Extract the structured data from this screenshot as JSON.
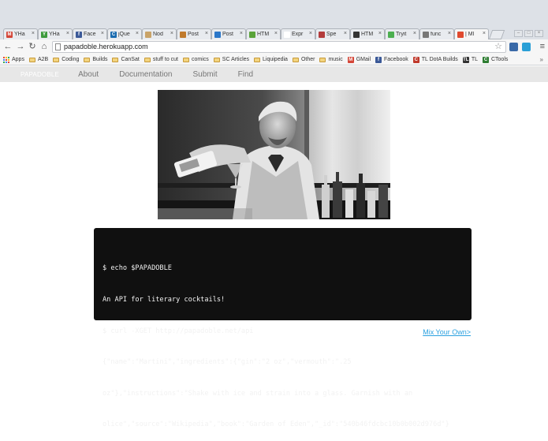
{
  "browser": {
    "tabs": [
      {
        "label": "YHa",
        "fav": "M",
        "color": "#d44638"
      },
      {
        "label": "YHa",
        "fav": "Y",
        "color": "#3d9a3d"
      },
      {
        "label": "Face",
        "fav": "f",
        "color": "#3b5998"
      },
      {
        "label": "jQue",
        "fav": "C",
        "color": "#1a6bb0"
      },
      {
        "label": "Nod",
        "fav": "",
        "color": "#c9a368"
      },
      {
        "label": "Post",
        "fav": "",
        "color": "#c07a2c"
      },
      {
        "label": "Post",
        "fav": "",
        "color": "#2b77c9"
      },
      {
        "label": "HTM",
        "fav": "",
        "color": "#5aa33a"
      },
      {
        "label": "Expr",
        "fav": "",
        "color": "#ffffff"
      },
      {
        "label": "Spe",
        "fav": "",
        "color": "#b33c3c"
      },
      {
        "label": "HTM",
        "fav": "",
        "color": "#333333"
      },
      {
        "label": "Tryit",
        "fav": "",
        "color": "#4caf50"
      },
      {
        "label": "func",
        "fav": "",
        "color": "#777777"
      },
      {
        "label": "| MI",
        "fav": "",
        "color": "#e04a2f"
      }
    ],
    "active_tab": 13,
    "url": "papadoble.herokuapp.com",
    "bookmarks": [
      {
        "label": "Apps",
        "type": "apps"
      },
      {
        "label": "A2B",
        "type": "folder"
      },
      {
        "label": "Coding",
        "type": "folder"
      },
      {
        "label": "Builds",
        "type": "folder"
      },
      {
        "label": "CanSat",
        "type": "folder"
      },
      {
        "label": "stuff to cut",
        "type": "folder"
      },
      {
        "label": "comics",
        "type": "folder"
      },
      {
        "label": "SC Articles",
        "type": "folder"
      },
      {
        "label": "Liquipedia",
        "type": "folder"
      },
      {
        "label": "Other",
        "type": "folder"
      },
      {
        "label": "music",
        "type": "folder"
      },
      {
        "label": "GMail",
        "type": "gmail"
      },
      {
        "label": "Facebook",
        "type": "facebook"
      },
      {
        "label": "TL DotA Builds",
        "type": "tl"
      },
      {
        "label": "TL",
        "type": "tl2"
      },
      {
        "label": "CTools",
        "type": "ctools"
      }
    ],
    "bookmarks_more": "»"
  },
  "site": {
    "brand": "PAPADOBLE",
    "nav": [
      "About",
      "Documentation",
      "Submit",
      "Find"
    ],
    "code_lines": [
      "$ echo $PAPADOBLE",
      "An API for literary cocktails!",
      "$ curl -XGET http://papadoble.net/api",
      "{\"name\":\"Martini\",\"ingredients\":{\"gin\":\"2 oz\",\"vermouth\":\".25",
      "oz\"},\"instructions\":\"Shake with ice and strain into a glass. Garnish with an",
      "olice\",\"source\":\"Wikipedia\",\"book\":\"Garden of Eden\",\"_id\":\"540b46fdcbc10b0b002d976d\"}"
    ],
    "mix_link": "Mix Your Own>"
  }
}
